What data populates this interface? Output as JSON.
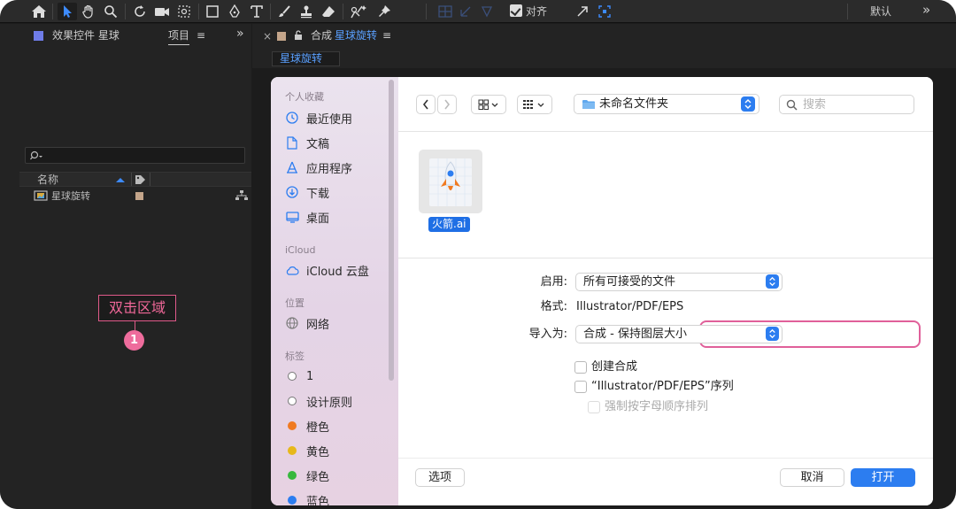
{
  "toolbar": {
    "align_label": "对齐",
    "workspace_label": "默认",
    "more_label": "»"
  },
  "left_panel": {
    "tab_effects": "效果控件 星球",
    "tab_project": "项目",
    "tab_menu": "≡",
    "expand": "»",
    "search_placeholder": "",
    "column_name": "名称",
    "item_name": "星球旋转",
    "callout_text": "双击区域",
    "callout_number": "1"
  },
  "comp_panel": {
    "close": "×",
    "lock": "🔓",
    "title_prefix": "合成",
    "title_name": "星球旋转",
    "menu": "≡",
    "tab_label": "星球旋转"
  },
  "dialog": {
    "sidebar": {
      "favorites_header": "个人收藏",
      "favorites": [
        {
          "label": "最近使用",
          "icon": "clock-icon"
        },
        {
          "label": "文稿",
          "icon": "document-icon"
        },
        {
          "label": "应用程序",
          "icon": "applications-icon"
        },
        {
          "label": "下载",
          "icon": "download-icon"
        },
        {
          "label": "桌面",
          "icon": "desktop-icon"
        }
      ],
      "icloud_header": "iCloud",
      "icloud_item": "iCloud 云盘",
      "locations_header": "位置",
      "network_item": "网络",
      "tags_header": "标签",
      "tags": [
        {
          "label": "1",
          "color": "#ffffff"
        },
        {
          "label": "设计原则",
          "color": "#ffffff"
        },
        {
          "label": "橙色",
          "color": "#f07a21"
        },
        {
          "label": "黄色",
          "color": "#e7b81a"
        },
        {
          "label": "绿色",
          "color": "#37b83d"
        },
        {
          "label": "蓝色",
          "color": "#2c7df0"
        }
      ]
    },
    "toolbar": {
      "back": "‹",
      "forward": "›",
      "location": "未命名文件夹",
      "search_placeholder": "搜索"
    },
    "file": {
      "name": "火箭.ai"
    },
    "form": {
      "enable_label": "启用:",
      "enable_value": "所有可接受的文件",
      "format_label": "格式:",
      "format_value": "Illustrator/PDF/EPS",
      "import_as_label": "导入为:",
      "import_as_value": "合成 - 保持图层大小",
      "create_comp": "创建合成",
      "sequence": "“Illustrator/PDF/EPS”序列",
      "force_alpha": "强制按字母顺序排列"
    },
    "buttons": {
      "options": "选项",
      "cancel": "取消",
      "open": "打开"
    }
  },
  "colors": {
    "accent_blue": "#2c7df0",
    "callout_pink": "#ee6c9c",
    "ae_link_blue": "#5aa0ff"
  }
}
